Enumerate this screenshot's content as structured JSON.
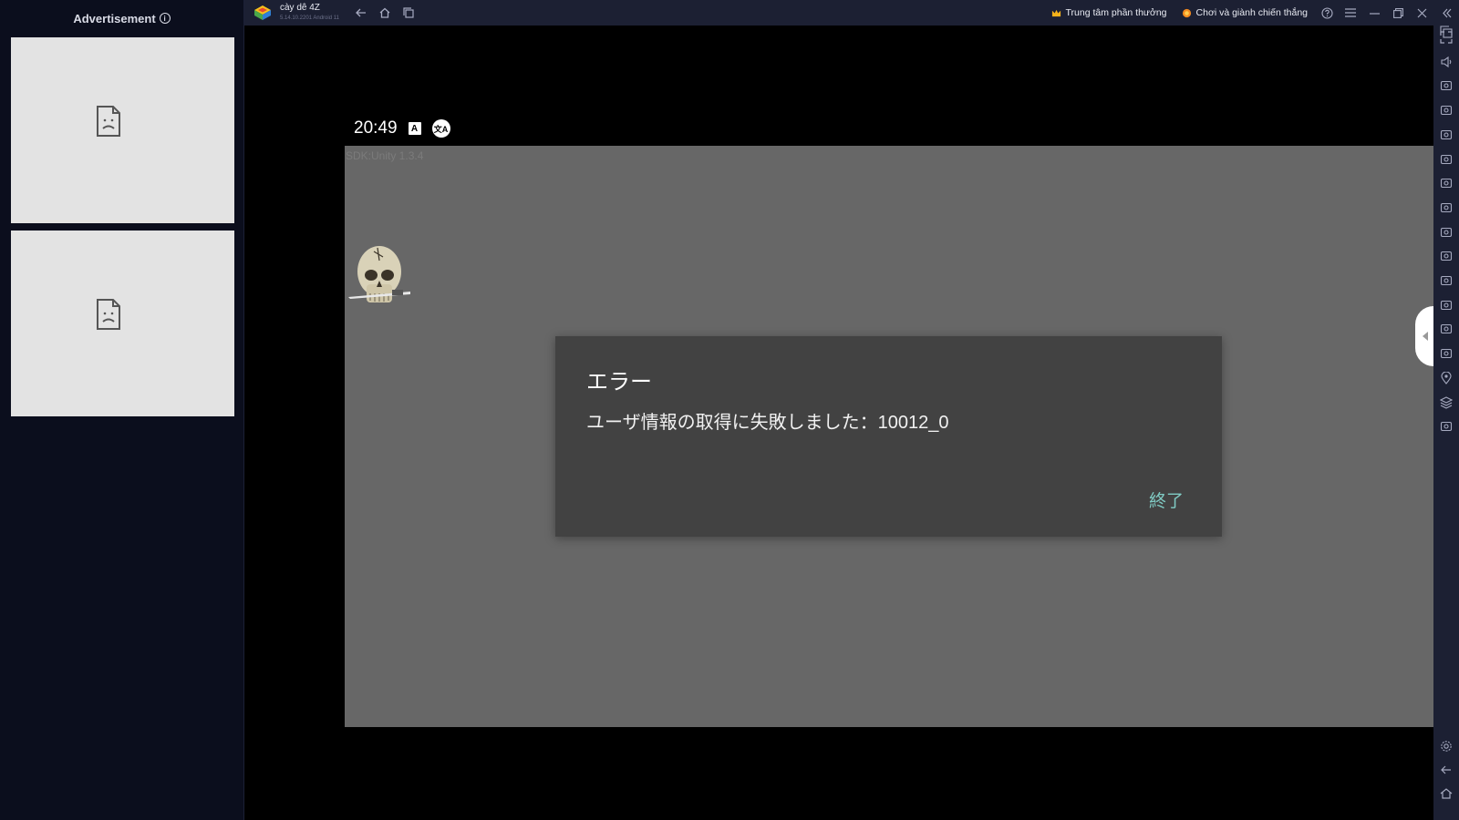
{
  "ad_panel": {
    "header": "Advertisement",
    "info_icon": "info-icon",
    "boxes": [
      {
        "icon": "broken-image-icon"
      },
      {
        "icon": "broken-image-icon"
      }
    ]
  },
  "topbar": {
    "app_name": "cày dê 4Z",
    "app_version": "5.14.10.2201 Android 11",
    "rewards_label": "Trung tâm phần thưởng",
    "play_win_label": "Chơi và giành chiến thắng",
    "icons": [
      "back-icon",
      "home-icon",
      "recent-apps-icon",
      "help-icon",
      "menu-icon",
      "minimize-icon",
      "restore-icon",
      "close-icon",
      "collapse-sidebar-icon"
    ]
  },
  "status_bar": {
    "time": "20:49",
    "icon_a": "A",
    "icon_translate": "文A"
  },
  "game": {
    "sdk_label": "SDK:Unity 1.3.4"
  },
  "dialog": {
    "title": "エラー",
    "message": "ユーザ情報の取得に失敗しました：10012_0",
    "button": "終了",
    "button_color": "#80cbc4"
  },
  "right_sidebar": {
    "icons": [
      "fullscreen-icon",
      "volume-icon",
      "media-icon",
      "keyboard-icon",
      "rotate-icon",
      "sync-icon",
      "controller-icon",
      "macro-icon",
      "screenshot-icon",
      "record-icon",
      "gallery-icon",
      "airplane-icon",
      "multi-instance-icon",
      "eco-mode-icon",
      "location-icon",
      "layers-icon",
      "refresh-icon",
      "settings-icon",
      "back-icon",
      "home-icon",
      "recent-apps-icon"
    ]
  },
  "colors": {
    "panel_bg": "#0b0e1d",
    "topbar_bg": "#1c2033",
    "game_bg": "#676767",
    "dialog_bg": "#424242"
  }
}
